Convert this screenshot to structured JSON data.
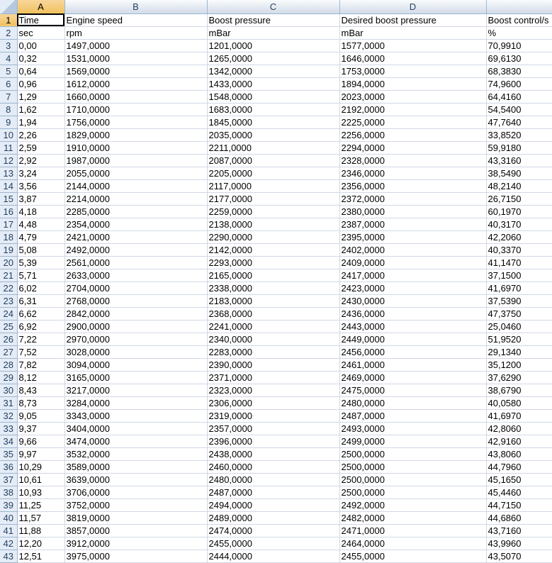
{
  "columns": [
    "A",
    "B",
    "C",
    "D",
    ""
  ],
  "rows": [
    [
      "Time",
      "Engine speed",
      "Boost pressure",
      "Desired boost pressure",
      "Boost control/s"
    ],
    [
      "sec",
      "rpm",
      "mBar",
      "mBar",
      "%"
    ],
    [
      "0,00",
      "1497,0000",
      "1201,0000",
      "1577,0000",
      "70,9910"
    ],
    [
      "0,32",
      "1531,0000",
      "1265,0000",
      "1646,0000",
      "69,6130"
    ],
    [
      "0,64",
      "1569,0000",
      "1342,0000",
      "1753,0000",
      "68,3830"
    ],
    [
      "0,96",
      "1612,0000",
      "1433,0000",
      "1894,0000",
      "74,9600"
    ],
    [
      "1,29",
      "1660,0000",
      "1548,0000",
      "2023,0000",
      "64,4160"
    ],
    [
      "1,62",
      "1710,0000",
      "1683,0000",
      "2192,0000",
      "54,5400"
    ],
    [
      "1,94",
      "1756,0000",
      "1845,0000",
      "2225,0000",
      "47,7640"
    ],
    [
      "2,26",
      "1829,0000",
      "2035,0000",
      "2256,0000",
      "33,8520"
    ],
    [
      "2,59",
      "1910,0000",
      "2211,0000",
      "2294,0000",
      "59,9180"
    ],
    [
      "2,92",
      "1987,0000",
      "2087,0000",
      "2328,0000",
      "43,3160"
    ],
    [
      "3,24",
      "2055,0000",
      "2205,0000",
      "2346,0000",
      "38,5490"
    ],
    [
      "3,56",
      "2144,0000",
      "2117,0000",
      "2356,0000",
      "48,2140"
    ],
    [
      "3,87",
      "2214,0000",
      "2177,0000",
      "2372,0000",
      "26,7150"
    ],
    [
      "4,18",
      "2285,0000",
      "2259,0000",
      "2380,0000",
      "60,1970"
    ],
    [
      "4,48",
      "2354,0000",
      "2138,0000",
      "2387,0000",
      "40,3170"
    ],
    [
      "4,79",
      "2421,0000",
      "2290,0000",
      "2395,0000",
      "42,2060"
    ],
    [
      "5,08",
      "2492,0000",
      "2142,0000",
      "2402,0000",
      "40,3370"
    ],
    [
      "5,39",
      "2561,0000",
      "2293,0000",
      "2409,0000",
      "41,1470"
    ],
    [
      "5,71",
      "2633,0000",
      "2165,0000",
      "2417,0000",
      "37,1500"
    ],
    [
      "6,02",
      "2704,0000",
      "2338,0000",
      "2423,0000",
      "41,6970"
    ],
    [
      "6,31",
      "2768,0000",
      "2183,0000",
      "2430,0000",
      "37,5390"
    ],
    [
      "6,62",
      "2842,0000",
      "2368,0000",
      "2436,0000",
      "47,3750"
    ],
    [
      "6,92",
      "2900,0000",
      "2241,0000",
      "2443,0000",
      "25,0460"
    ],
    [
      "7,22",
      "2970,0000",
      "2340,0000",
      "2449,0000",
      "51,9520"
    ],
    [
      "7,52",
      "3028,0000",
      "2283,0000",
      "2456,0000",
      "29,1340"
    ],
    [
      "7,82",
      "3094,0000",
      "2390,0000",
      "2461,0000",
      "35,1200"
    ],
    [
      "8,12",
      "3165,0000",
      "2371,0000",
      "2469,0000",
      "37,6290"
    ],
    [
      "8,43",
      "3217,0000",
      "2323,0000",
      "2475,0000",
      "38,6790"
    ],
    [
      "8,73",
      "3284,0000",
      "2306,0000",
      "2480,0000",
      "40,0580"
    ],
    [
      "9,05",
      "3343,0000",
      "2319,0000",
      "2487,0000",
      "41,6970"
    ],
    [
      "9,37",
      "3404,0000",
      "2357,0000",
      "2493,0000",
      "42,8060"
    ],
    [
      "9,66",
      "3474,0000",
      "2396,0000",
      "2499,0000",
      "42,9160"
    ],
    [
      "9,97",
      "3532,0000",
      "2438,0000",
      "2500,0000",
      "43,8060"
    ],
    [
      "10,29",
      "3589,0000",
      "2460,0000",
      "2500,0000",
      "44,7960"
    ],
    [
      "10,61",
      "3639,0000",
      "2480,0000",
      "2500,0000",
      "45,1650"
    ],
    [
      "10,93",
      "3706,0000",
      "2487,0000",
      "2500,0000",
      "45,4460"
    ],
    [
      "11,25",
      "3752,0000",
      "2494,0000",
      "2492,0000",
      "44,7150"
    ],
    [
      "11,57",
      "3819,0000",
      "2489,0000",
      "2482,0000",
      "44,6860"
    ],
    [
      "11,88",
      "3857,0000",
      "2474,0000",
      "2471,0000",
      "43,7160"
    ],
    [
      "12,20",
      "3912,0000",
      "2455,0000",
      "2464,0000",
      "43,9960"
    ],
    [
      "12,51",
      "3975,0000",
      "2444,0000",
      "2455,0000",
      "43,5070"
    ]
  ]
}
